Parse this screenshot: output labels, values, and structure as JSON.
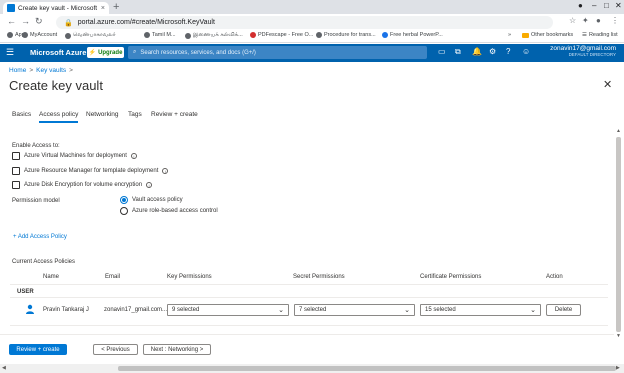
{
  "browser": {
    "tab_title": "Create key vault - Microsoft Azu",
    "tab_close": "×",
    "new_tab": "+",
    "url": "portal.azure.com/#create/Microsoft.KeyVault",
    "bookmarks": [
      {
        "label": "Apps",
        "icon": "apps-grid-icon"
      },
      {
        "label": "MyAccount",
        "icon": "favicon"
      },
      {
        "label": "வெண்பாகாவலர்",
        "icon": "favicon"
      },
      {
        "label": "Tamil M...",
        "icon": "favicon"
      },
      {
        "label": "இணையக் கல்விக்...",
        "icon": "favicon"
      },
      {
        "label": "PDFescape - Free O...",
        "icon": "favicon"
      },
      {
        "label": "Procedure for trans...",
        "icon": "favicon"
      },
      {
        "label": "Free herbal PowerP...",
        "icon": "favicon"
      }
    ],
    "more": "»",
    "other_bookmarks": "Other bookmarks",
    "reading_list": "Reading list"
  },
  "azure": {
    "brand": "Microsoft Azure",
    "upgrade": "Upgrade",
    "search_placeholder": "Search resources, services, and docs (G+/)",
    "user": "zonavin17@gmail.com",
    "directory": "DEFAULT DIRECTORY",
    "notification_count": "1"
  },
  "breadcrumb": {
    "home": "Home",
    "sep": ">",
    "current": "Key vaults",
    "sep2": ">"
  },
  "page_title": "Create key vault",
  "tabs": [
    "Basics",
    "Access policy",
    "Networking",
    "Tags",
    "Review + create"
  ],
  "enable_access_label": "Enable Access to:",
  "checkboxes": [
    "Azure Virtual Machines for deployment",
    "Azure Resource Manager for template deployment",
    "Azure Disk Encryption for volume encryption"
  ],
  "permission_model_label": "Permission model",
  "permission_options": [
    {
      "label": "Vault access policy",
      "selected": true
    },
    {
      "label": "Azure role-based access control",
      "selected": false
    }
  ],
  "add_access_policy": "+ Add Access Policy",
  "current_access_policies": "Current Access Policies",
  "table": {
    "headers": [
      "Name",
      "Email",
      "Key Permissions",
      "Secret Permissions",
      "Certificate Permissions",
      "Action"
    ],
    "group": "USER",
    "rows": [
      {
        "name": "Pravin Tankaraj J",
        "email": "zonavin17_gmail.com...",
        "key": "9 selected",
        "secret": "7 selected",
        "certificate": "15 selected",
        "action": "Delete"
      }
    ]
  },
  "footer": {
    "review": "Review + create",
    "previous": "< Previous",
    "next": "Next : Networking >"
  },
  "colors": {
    "azure_bar": "#0062ad",
    "accent": "#0078d4"
  }
}
